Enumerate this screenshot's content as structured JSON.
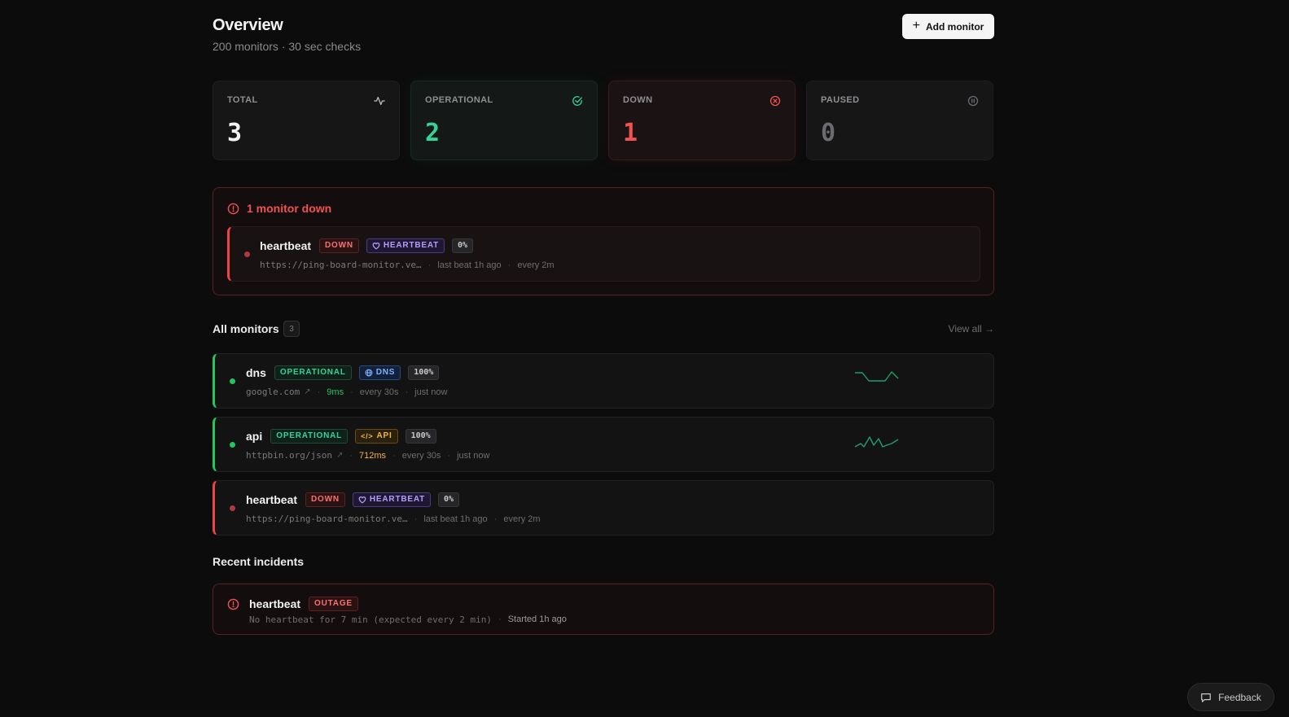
{
  "header": {
    "title": "Overview",
    "subtitle": "200 monitors · 30 sec checks",
    "add_button": "Add monitor"
  },
  "stats": [
    {
      "label": "TOTAL",
      "value": "3",
      "icon": "activity-icon",
      "color": "#f2f2f2"
    },
    {
      "label": "OPERATIONAL",
      "value": "2",
      "icon": "check-circle-icon",
      "color": "#34d399"
    },
    {
      "label": "DOWN",
      "value": "1",
      "icon": "x-circle-icon",
      "color": "#f05252"
    },
    {
      "label": "PAUSED",
      "value": "0",
      "icon": "pause-circle-icon",
      "color": "#6b6b70"
    }
  ],
  "alert": {
    "title": "1 monitor down",
    "monitor": {
      "name": "heartbeat",
      "status": "DOWN",
      "type": "HEARTBEAT",
      "uptime": "0%",
      "url": "https://ping-board-monitor.ve…",
      "last": "last beat 1h ago",
      "interval": "every 2m"
    }
  },
  "all_monitors": {
    "title": "All monitors",
    "count": "3",
    "view_all": "View all →",
    "items": [
      {
        "name": "dns",
        "status": "OPERATIONAL",
        "type": "DNS",
        "uptime": "100%",
        "url": "google.com",
        "latency": "9ms",
        "interval": "every 30s",
        "last": "just now"
      },
      {
        "name": "api",
        "status": "OPERATIONAL",
        "type": "API",
        "uptime": "100%",
        "url": "httpbin.org/json",
        "latency": "712ms",
        "interval": "every 30s",
        "last": "just now"
      },
      {
        "name": "heartbeat",
        "status": "DOWN",
        "type": "HEARTBEAT",
        "uptime": "0%",
        "url": "https://ping-board-monitor.ve…",
        "last": "last beat 1h ago",
        "interval": "every 2m"
      }
    ]
  },
  "incidents": {
    "title": "Recent incidents",
    "items": [
      {
        "name": "heartbeat",
        "tag": "OUTAGE",
        "message": "No heartbeat for 7 min (expected every 2 min)",
        "started": "Started 1h ago"
      }
    ]
  },
  "feedback": "Feedback",
  "colors": {
    "green": "#22c55e",
    "red": "#ef4444",
    "latency_green": "#22c55e",
    "latency_amber": "#f3b43c"
  }
}
